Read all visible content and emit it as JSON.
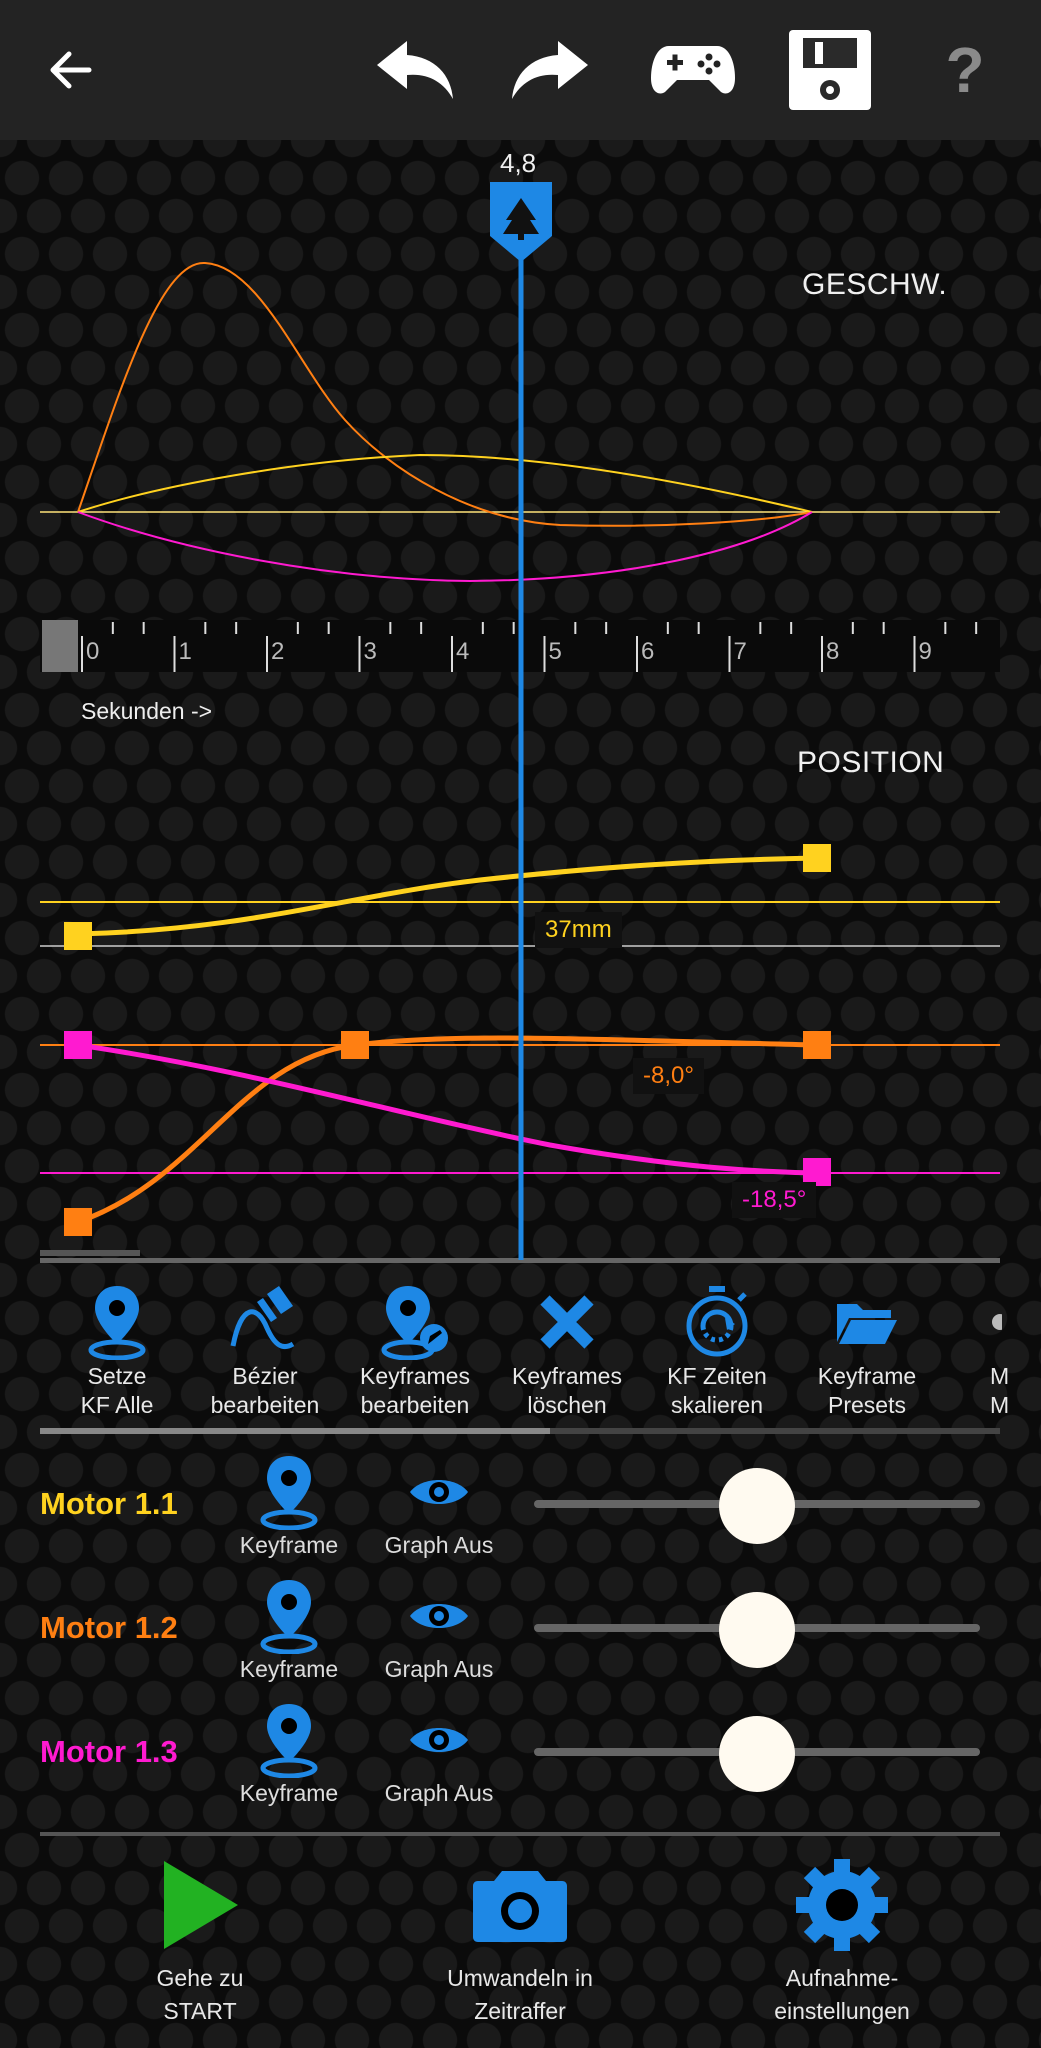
{
  "topbar": {
    "help_label": "?"
  },
  "playhead": {
    "time_label": "4,8"
  },
  "speed_graph": {
    "label": "GESCHW."
  },
  "timeline": {
    "ticks": [
      "0",
      "1",
      "2",
      "3",
      "4",
      "5",
      "6",
      "7",
      "8",
      "9"
    ],
    "unit_label": "Sekunden ->"
  },
  "position_graph": {
    "label": "POSITION",
    "values": {
      "m1": "37mm",
      "m2": "-8,0°",
      "m3": "-18,5°"
    }
  },
  "tools": [
    {
      "label1": "Setze",
      "label2": "KF Alle"
    },
    {
      "label1": "Bézier",
      "label2": "bearbeiten"
    },
    {
      "label1": "Keyframes",
      "label2": "bearbeiten"
    },
    {
      "label1": "Keyframes",
      "label2": "löschen"
    },
    {
      "label1": "KF Zeiten",
      "label2": "skalieren"
    },
    {
      "label1": "Keyframe",
      "label2": "Presets"
    },
    {
      "label1": "M",
      "label2": "M"
    }
  ],
  "motors": [
    {
      "name": "Motor 1.1",
      "color": "#ffd21f",
      "keyframe_label": "Keyframe",
      "graph_label": "Graph Aus",
      "level": 0.5
    },
    {
      "name": "Motor 1.2",
      "color": "#ff7f12",
      "keyframe_label": "Keyframe",
      "graph_label": "Graph Aus",
      "level": 0.5
    },
    {
      "name": "Motor 1.3",
      "color": "#ff1ad0",
      "keyframe_label": "Keyframe",
      "graph_label": "Graph Aus",
      "level": 0.5
    }
  ],
  "bottom": {
    "start": {
      "label1": "Gehe zu",
      "label2": "START"
    },
    "convert": {
      "label1": "Umwandeln in",
      "label2": "Zeitraffer"
    },
    "settings": {
      "label1": "Aufnahme-",
      "label2": "einstellungen"
    }
  },
  "colors": {
    "accent": "#1e88e5",
    "motor1": "#ffd21f",
    "motor2": "#ff7f12",
    "motor3": "#ff1ad0",
    "play": "#22b222"
  }
}
